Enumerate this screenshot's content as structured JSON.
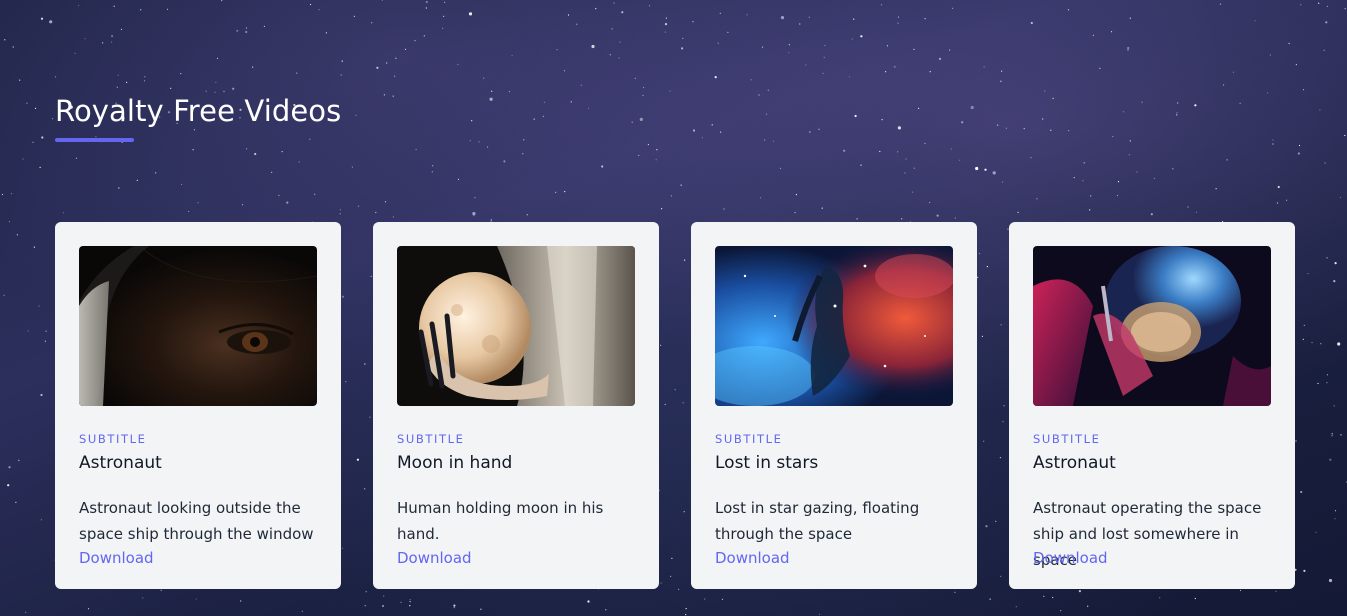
{
  "page": {
    "title": "Royalty Free Videos",
    "accent_color": "#6366f1"
  },
  "cards": [
    {
      "thumbnail_icon": "astronaut-eye-image",
      "subtitle": "SUBTITLE",
      "title": "Astronaut",
      "description": "Astronaut looking outside the space ship through the window",
      "link_label": "Download"
    },
    {
      "thumbnail_icon": "moon-in-hand-image",
      "subtitle": "SUBTITLE",
      "title": "Moon in hand",
      "description": "Human holding moon in his hand.",
      "link_label": "Download"
    },
    {
      "thumbnail_icon": "nebula-figure-image",
      "subtitle": "SUBTITLE",
      "title": "Lost in stars",
      "description": "Lost in star gazing, floating through the space",
      "link_label": "Download"
    },
    {
      "thumbnail_icon": "astronaut-helmet-image",
      "subtitle": "SUBTITLE",
      "title": "Astronaut",
      "description": "Astronaut operating the space ship and lost somewhere in space",
      "link_label": "Download"
    }
  ]
}
